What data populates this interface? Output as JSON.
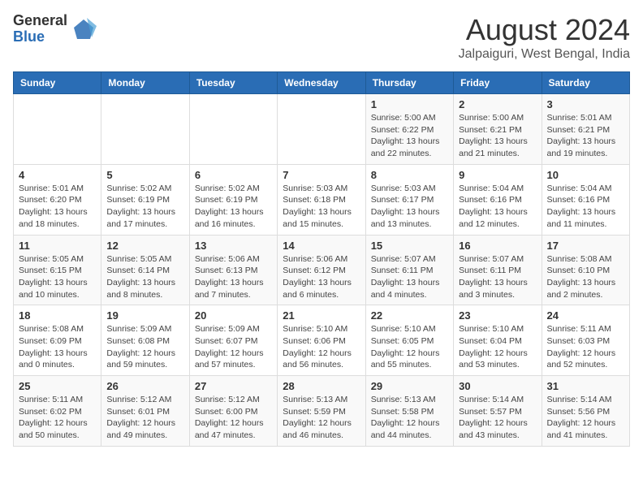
{
  "header": {
    "logo_general": "General",
    "logo_blue": "Blue",
    "main_title": "August 2024",
    "subtitle": "Jalpaiguri, West Bengal, India"
  },
  "calendar": {
    "days_of_week": [
      "Sunday",
      "Monday",
      "Tuesday",
      "Wednesday",
      "Thursday",
      "Friday",
      "Saturday"
    ],
    "weeks": [
      [
        {
          "day": "",
          "info": ""
        },
        {
          "day": "",
          "info": ""
        },
        {
          "day": "",
          "info": ""
        },
        {
          "day": "",
          "info": ""
        },
        {
          "day": "1",
          "info": "Sunrise: 5:00 AM\nSunset: 6:22 PM\nDaylight: 13 hours\nand 22 minutes."
        },
        {
          "day": "2",
          "info": "Sunrise: 5:00 AM\nSunset: 6:21 PM\nDaylight: 13 hours\nand 21 minutes."
        },
        {
          "day": "3",
          "info": "Sunrise: 5:01 AM\nSunset: 6:21 PM\nDaylight: 13 hours\nand 19 minutes."
        }
      ],
      [
        {
          "day": "4",
          "info": "Sunrise: 5:01 AM\nSunset: 6:20 PM\nDaylight: 13 hours\nand 18 minutes."
        },
        {
          "day": "5",
          "info": "Sunrise: 5:02 AM\nSunset: 6:19 PM\nDaylight: 13 hours\nand 17 minutes."
        },
        {
          "day": "6",
          "info": "Sunrise: 5:02 AM\nSunset: 6:19 PM\nDaylight: 13 hours\nand 16 minutes."
        },
        {
          "day": "7",
          "info": "Sunrise: 5:03 AM\nSunset: 6:18 PM\nDaylight: 13 hours\nand 15 minutes."
        },
        {
          "day": "8",
          "info": "Sunrise: 5:03 AM\nSunset: 6:17 PM\nDaylight: 13 hours\nand 13 minutes."
        },
        {
          "day": "9",
          "info": "Sunrise: 5:04 AM\nSunset: 6:16 PM\nDaylight: 13 hours\nand 12 minutes."
        },
        {
          "day": "10",
          "info": "Sunrise: 5:04 AM\nSunset: 6:16 PM\nDaylight: 13 hours\nand 11 minutes."
        }
      ],
      [
        {
          "day": "11",
          "info": "Sunrise: 5:05 AM\nSunset: 6:15 PM\nDaylight: 13 hours\nand 10 minutes."
        },
        {
          "day": "12",
          "info": "Sunrise: 5:05 AM\nSunset: 6:14 PM\nDaylight: 13 hours\nand 8 minutes."
        },
        {
          "day": "13",
          "info": "Sunrise: 5:06 AM\nSunset: 6:13 PM\nDaylight: 13 hours\nand 7 minutes."
        },
        {
          "day": "14",
          "info": "Sunrise: 5:06 AM\nSunset: 6:12 PM\nDaylight: 13 hours\nand 6 minutes."
        },
        {
          "day": "15",
          "info": "Sunrise: 5:07 AM\nSunset: 6:11 PM\nDaylight: 13 hours\nand 4 minutes."
        },
        {
          "day": "16",
          "info": "Sunrise: 5:07 AM\nSunset: 6:11 PM\nDaylight: 13 hours\nand 3 minutes."
        },
        {
          "day": "17",
          "info": "Sunrise: 5:08 AM\nSunset: 6:10 PM\nDaylight: 13 hours\nand 2 minutes."
        }
      ],
      [
        {
          "day": "18",
          "info": "Sunrise: 5:08 AM\nSunset: 6:09 PM\nDaylight: 13 hours\nand 0 minutes."
        },
        {
          "day": "19",
          "info": "Sunrise: 5:09 AM\nSunset: 6:08 PM\nDaylight: 12 hours\nand 59 minutes."
        },
        {
          "day": "20",
          "info": "Sunrise: 5:09 AM\nSunset: 6:07 PM\nDaylight: 12 hours\nand 57 minutes."
        },
        {
          "day": "21",
          "info": "Sunrise: 5:10 AM\nSunset: 6:06 PM\nDaylight: 12 hours\nand 56 minutes."
        },
        {
          "day": "22",
          "info": "Sunrise: 5:10 AM\nSunset: 6:05 PM\nDaylight: 12 hours\nand 55 minutes."
        },
        {
          "day": "23",
          "info": "Sunrise: 5:10 AM\nSunset: 6:04 PM\nDaylight: 12 hours\nand 53 minutes."
        },
        {
          "day": "24",
          "info": "Sunrise: 5:11 AM\nSunset: 6:03 PM\nDaylight: 12 hours\nand 52 minutes."
        }
      ],
      [
        {
          "day": "25",
          "info": "Sunrise: 5:11 AM\nSunset: 6:02 PM\nDaylight: 12 hours\nand 50 minutes."
        },
        {
          "day": "26",
          "info": "Sunrise: 5:12 AM\nSunset: 6:01 PM\nDaylight: 12 hours\nand 49 minutes."
        },
        {
          "day": "27",
          "info": "Sunrise: 5:12 AM\nSunset: 6:00 PM\nDaylight: 12 hours\nand 47 minutes."
        },
        {
          "day": "28",
          "info": "Sunrise: 5:13 AM\nSunset: 5:59 PM\nDaylight: 12 hours\nand 46 minutes."
        },
        {
          "day": "29",
          "info": "Sunrise: 5:13 AM\nSunset: 5:58 PM\nDaylight: 12 hours\nand 44 minutes."
        },
        {
          "day": "30",
          "info": "Sunrise: 5:14 AM\nSunset: 5:57 PM\nDaylight: 12 hours\nand 43 minutes."
        },
        {
          "day": "31",
          "info": "Sunrise: 5:14 AM\nSunset: 5:56 PM\nDaylight: 12 hours\nand 41 minutes."
        }
      ]
    ]
  }
}
